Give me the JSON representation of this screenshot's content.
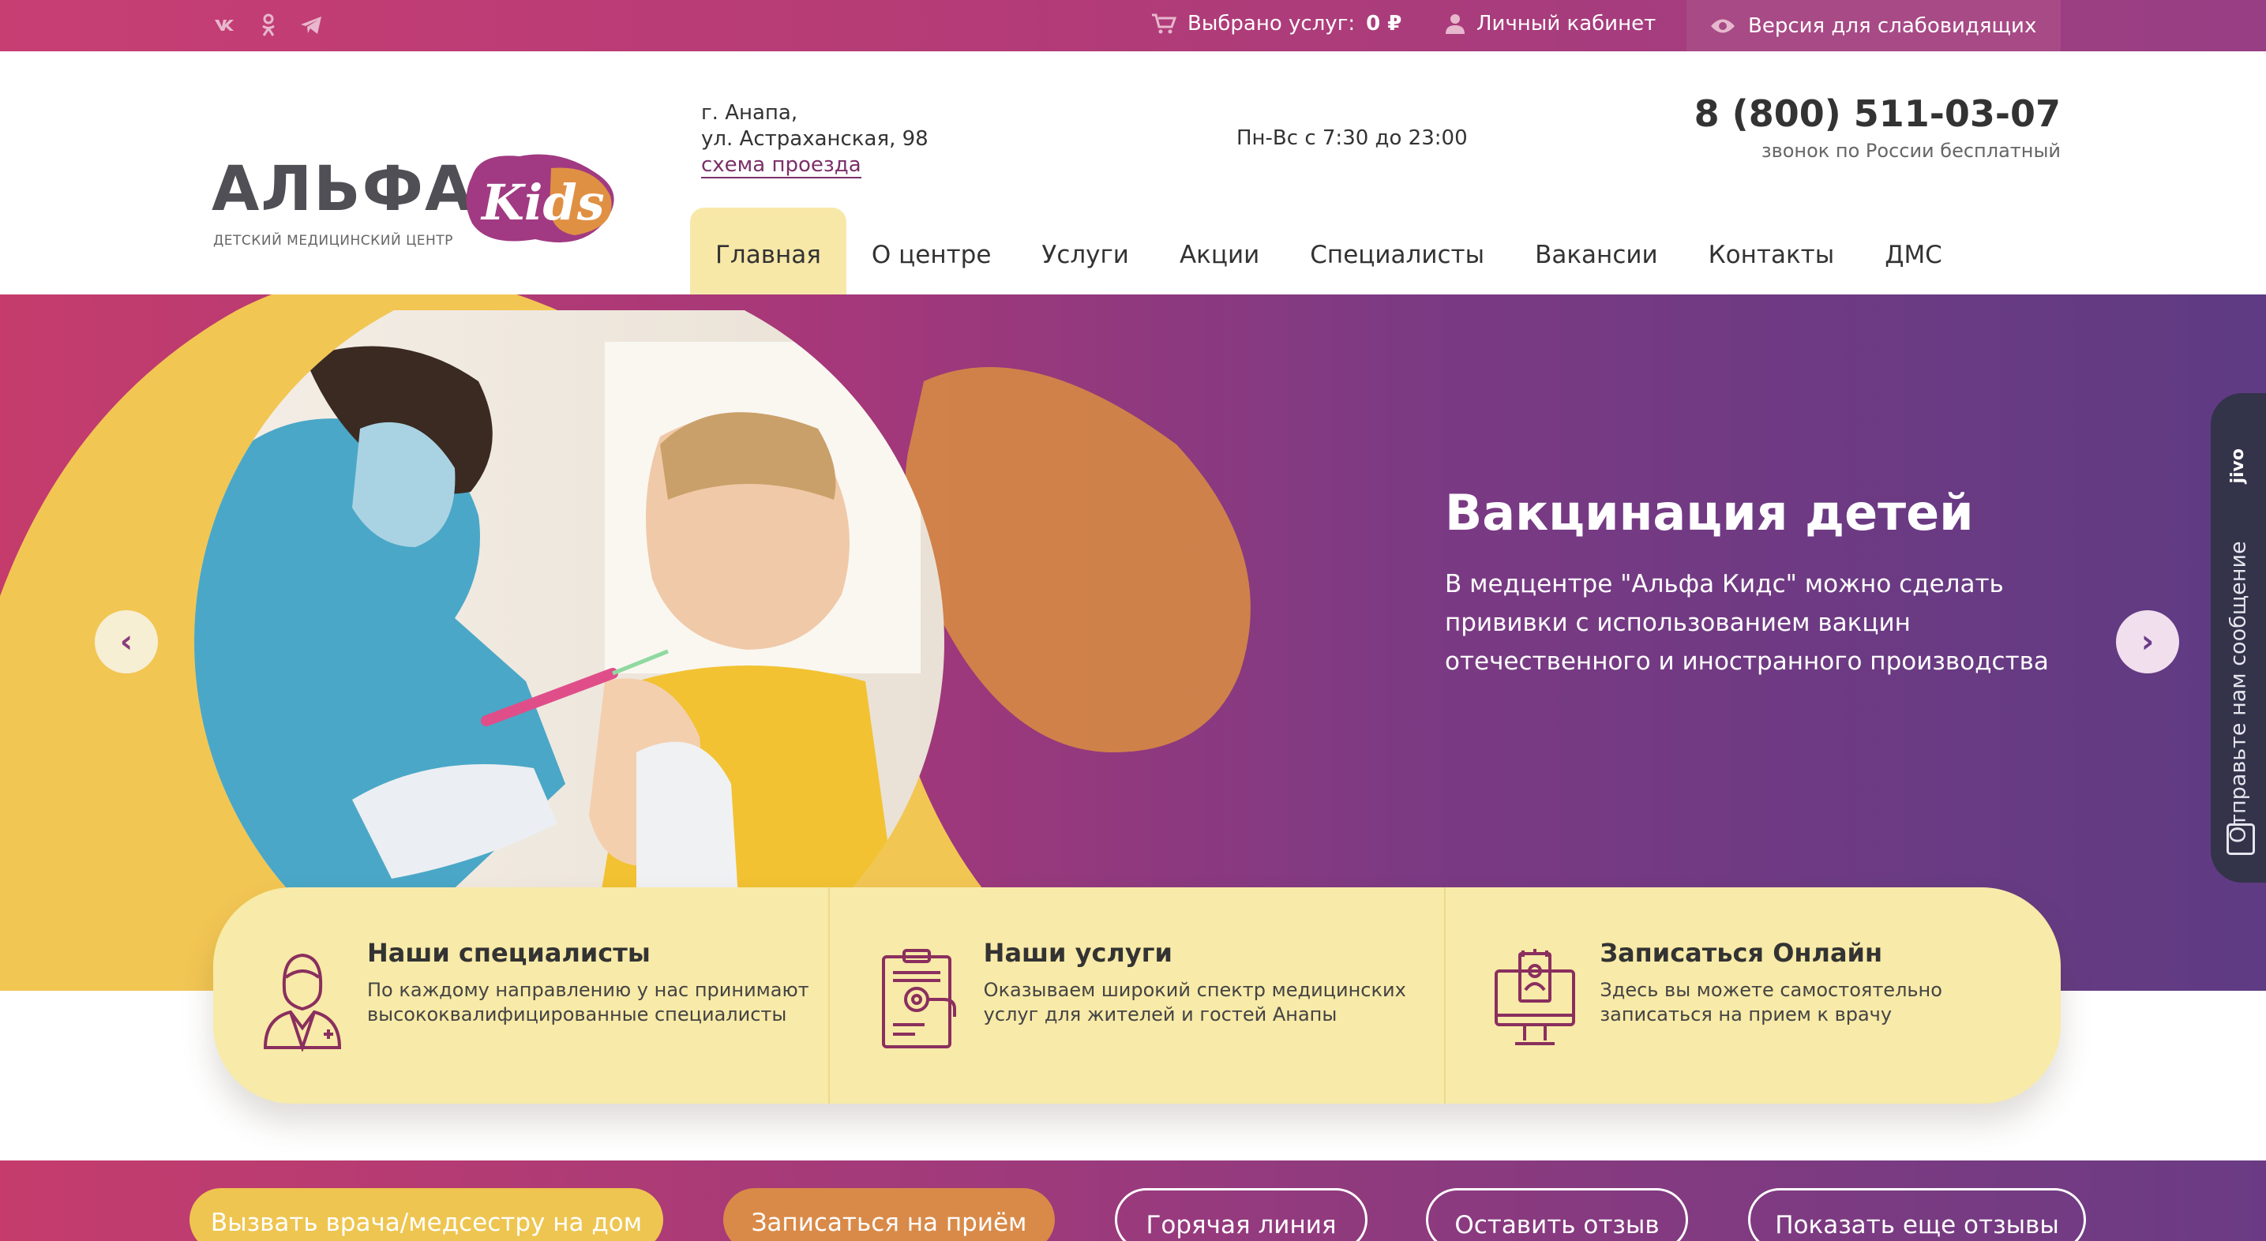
{
  "topbar": {
    "social": [
      {
        "name": "vk-icon",
        "glyph": "vk"
      },
      {
        "name": "odnoklassniki-icon",
        "glyph": "ok"
      },
      {
        "name": "telegram-icon",
        "glyph": "tg"
      }
    ],
    "cart_label": "Выбрано услуг:",
    "cart_value": "0 ₽",
    "cabinet_label": "Личный кабинет",
    "vision_label": "Версия для слабовидящих"
  },
  "header": {
    "logo_word": "АЛЬФА",
    "logo_kids": "Kids",
    "logo_subtitle": "ДЕТСКИЙ МЕДИЦИНСКИЙ ЦЕНТР",
    "address_city": "г. Анапа,",
    "address_street": "ул. Астраханская, 98",
    "address_link": "схема проезда",
    "hours": "Пн-Вс с 7:30 до 23:00",
    "phone": "8 (800) 511-03-07",
    "phone_note": "звонок по России бесплатный"
  },
  "nav": {
    "items": [
      {
        "label": "Главная",
        "active": true
      },
      {
        "label": "О центре",
        "active": false
      },
      {
        "label": "Услуги",
        "active": false
      },
      {
        "label": "Акции",
        "active": false
      },
      {
        "label": "Специалисты",
        "active": false
      },
      {
        "label": "Вакансии",
        "active": false
      },
      {
        "label": "Контакты",
        "active": false
      },
      {
        "label": "ДМС",
        "active": false
      }
    ]
  },
  "hero": {
    "title": "Вакцинация детей",
    "text": "В медцентре \"Альфа Кидс\" можно сделать прививки с использованием вакцин отечественного и иностранного производства",
    "prev_icon": "‹",
    "next_icon": "›"
  },
  "cards": [
    {
      "title": "Наши специалисты",
      "text": "По каждому направлению у нас принимают высококвалифицированные специалисты",
      "icon": "doctor-icon"
    },
    {
      "title": "Наши услуги",
      "text": "Оказываем широкий спектр медицинских услуг для жителей и гостей Анапы",
      "icon": "clipboard-icon"
    },
    {
      "title": "Записаться Онлайн",
      "text": "Здесь вы можете самостоятельно записаться на прием к врачу",
      "icon": "monitor-appointment-icon"
    }
  ],
  "bottom_buttons": [
    {
      "label": "Вызвать врача/медсестру на дом",
      "style": "yellow"
    },
    {
      "label": "Записаться на приём",
      "style": "orange"
    },
    {
      "label": "Горячая линия",
      "style": "outline"
    },
    {
      "label": "Оставить отзыв",
      "style": "outline"
    },
    {
      "label": "Показать еще отзывы",
      "style": "outline"
    }
  ],
  "chat": {
    "brand": "jivo",
    "label": "Отправьте нам сообщение"
  },
  "colors": {
    "brand_magenta": "#c73e73",
    "brand_purple": "#5e3b83",
    "accent_yellow": "#eec550",
    "card_bg": "#f8eaa8",
    "icon_plum": "#8a2f5e"
  }
}
